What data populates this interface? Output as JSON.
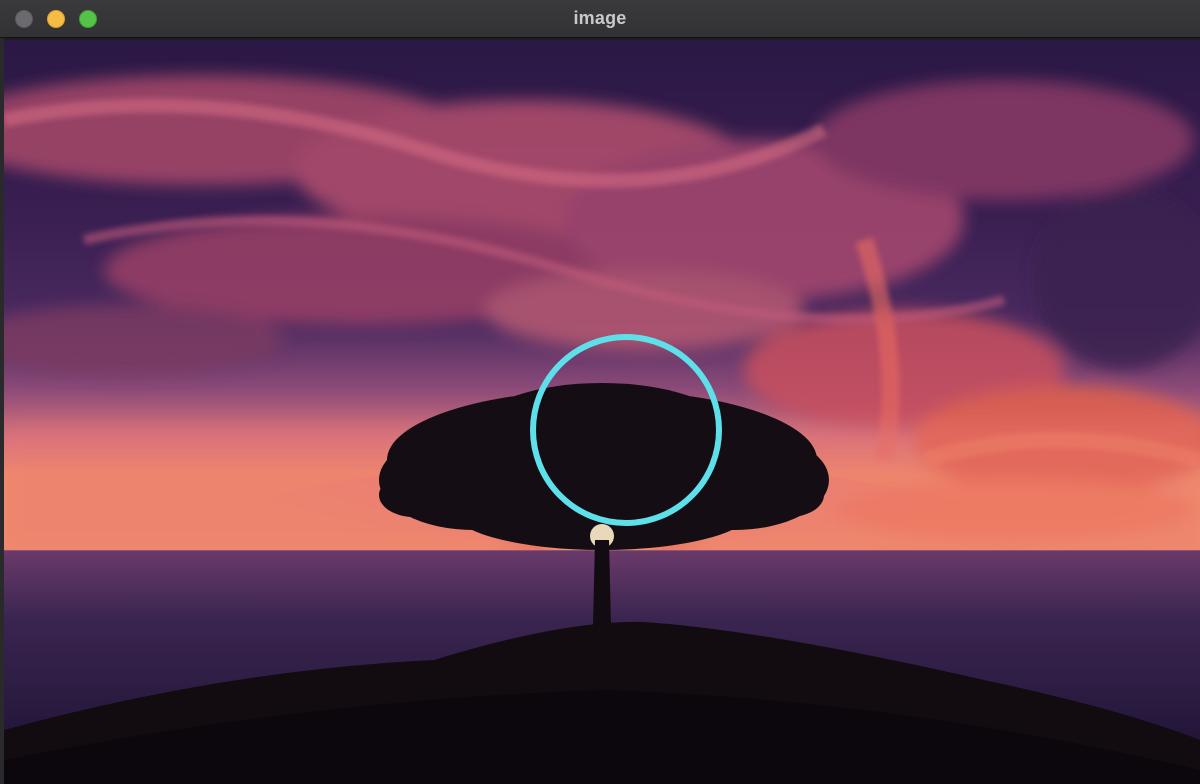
{
  "window": {
    "title": "image",
    "controls": [
      "close",
      "minimize",
      "zoom"
    ]
  },
  "colors": {
    "close_button": "#6b6a6e",
    "minimize_button": "#f6bd45",
    "zoom_button": "#55c24a",
    "circle_overlay": "#5ee0ea",
    "sky_top": "#2a1845",
    "horizon_glow": "#e8706a",
    "sea": "#2a1c40"
  },
  "image": {
    "scene": "sunset-tree-over-sea",
    "overlay_shape": "circle"
  }
}
